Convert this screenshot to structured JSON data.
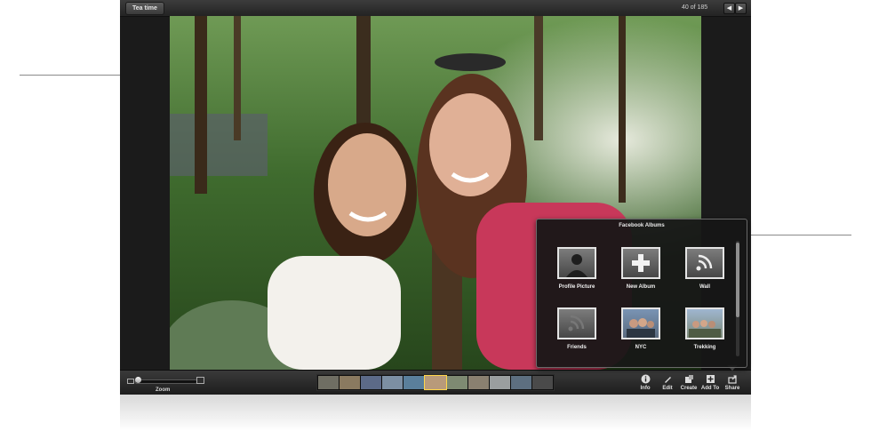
{
  "header": {
    "event_name": "Tea time",
    "photo_counter": "40 of 185",
    "prev_icon": "left-arrow-icon",
    "next_icon": "right-arrow-icon"
  },
  "bottom_bar": {
    "zoom_label": "Zoom",
    "tools": [
      {
        "label": "Info",
        "icon": "info-icon"
      },
      {
        "label": "Edit",
        "icon": "pencil-icon"
      },
      {
        "label": "Create",
        "icon": "create-icon"
      },
      {
        "label": "Add To",
        "icon": "add-to-icon"
      },
      {
        "label": "Share",
        "icon": "share-icon"
      }
    ],
    "filmstrip_selected_index": 5
  },
  "facebook_popover": {
    "title": "Facebook Albums",
    "albums": [
      {
        "label": "Profile Picture",
        "icon": "person-silhouette-icon"
      },
      {
        "label": "New Album",
        "icon": "plus-icon"
      },
      {
        "label": "Wall",
        "icon": "feed-icon"
      },
      {
        "label": "Friends",
        "icon": "feed-icon"
      },
      {
        "label": "NYC",
        "icon": "photo-stack-icon"
      },
      {
        "label": "Trekking",
        "icon": "photo-stack-icon"
      }
    ]
  },
  "colors": {
    "selection": "#ffd64a",
    "chrome": "#1b1b1b"
  }
}
